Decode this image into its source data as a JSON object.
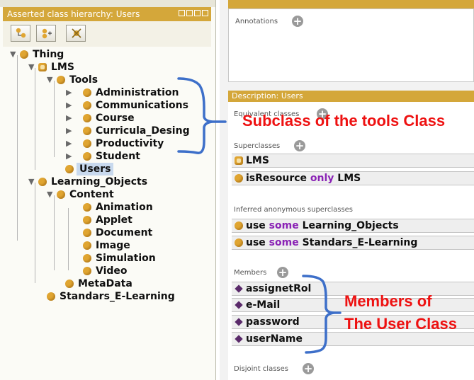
{
  "left_panel": {
    "title": "Asserted class hierarchy: Users",
    "toolbar": [
      "add-subclass-icon",
      "add-sibling-icon",
      "delete-class-icon"
    ]
  },
  "tree": {
    "thing": "Thing",
    "lms": "LMS",
    "tools": "Tools",
    "administration": "Administration",
    "communications": "Communications",
    "course": "Course",
    "curricula_desing": "Curricula_Desing",
    "productivity": "Productivity",
    "student": "Student",
    "users": "Users",
    "learning_objects": "Learning_Objects",
    "content": "Content",
    "animation": "Animation",
    "applet": "Applet",
    "document": "Document",
    "image": "Image",
    "simulation": "Simulation",
    "video": "Video",
    "metadata": "MetaData",
    "standars": "Standars_E-Learning"
  },
  "annotations": {
    "label": "Annotations"
  },
  "description": {
    "header": "Description: Users",
    "equivalent_label": "Equivalent classes",
    "superclasses_label": "Superclasses",
    "superclasses": {
      "lms": "LMS",
      "isresource_prop": "isResource",
      "isresource_kw": "only",
      "isresource_target": "LMS"
    },
    "inferred_label": "Inferred anonymous superclasses",
    "inferred": {
      "r1_prop": "use",
      "r1_kw": "some",
      "r1_target": "Learning_Objects",
      "r2_prop": "use",
      "r2_kw": "some",
      "r2_target": "Standars_E-Learning"
    },
    "members_label": "Members",
    "members": [
      "assignetRol",
      "e-Mail",
      "password",
      "userName"
    ],
    "disjoint_label": "Disjoint classes"
  },
  "callouts": {
    "subclass_note": "Subclass of the tools Class",
    "members_note_line1": "Members of",
    "members_note_line2": "The User Class"
  },
  "colors": {
    "accent": "#d4a73a",
    "class_bullet": "#e0a531",
    "callout_red": "#ee1111",
    "bracket_blue": "#3d6fc9",
    "keyword_purple": "#8a22b5",
    "individual_diamond": "#5a2a6a"
  }
}
